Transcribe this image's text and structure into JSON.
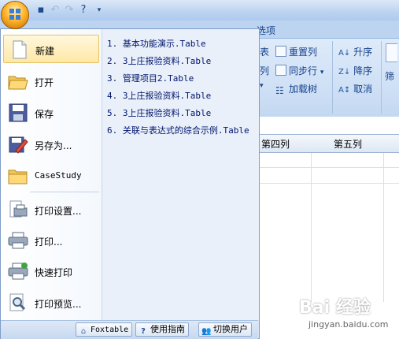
{
  "ribbon": {
    "tab_label": "选项",
    "buttons": {
      "reset_columns": "重置列",
      "sync_rows": "同步行",
      "load_tree": "加载树",
      "sort_asc": "升序",
      "sort_desc": "降序",
      "cancel_sort": "取消",
      "filter_partial": "筛",
      "table_partial": "表",
      "column_partial": "列"
    }
  },
  "grid": {
    "columns": [
      "第四列",
      "第五列"
    ]
  },
  "app_menu": {
    "items": [
      {
        "label": "新建",
        "icon": "new-document-icon"
      },
      {
        "label": "打开",
        "icon": "open-folder-icon"
      },
      {
        "label": "保存",
        "icon": "save-disk-icon"
      },
      {
        "label": "另存为...",
        "icon": "save-as-icon"
      },
      {
        "label": "CaseStudy",
        "icon": "folder-icon"
      },
      {
        "label": "打印设置...",
        "icon": "print-setup-icon"
      },
      {
        "label": "打印...",
        "icon": "printer-icon"
      },
      {
        "label": "快速打印",
        "icon": "quick-print-icon"
      },
      {
        "label": "打印预览...",
        "icon": "print-preview-icon"
      }
    ],
    "recent_files": [
      "1. 基本功能演示.Table",
      "2. 3上庄报验资料.Table",
      "3. 管理项目2.Table",
      "4. 3上庄报验资料.Table",
      "5. 3上庄报验资料.Table",
      "6. 关联与表达式的综合示例.Table"
    ],
    "bottom_buttons": [
      {
        "label": "Foxtable",
        "icon": "home-icon"
      },
      {
        "label": "使用指南",
        "icon": "help-icon"
      },
      {
        "label": "切换用户",
        "icon": "users-icon"
      }
    ]
  },
  "watermark": {
    "brand": "Bai 经验",
    "url": "jingyan.baidu.com"
  }
}
